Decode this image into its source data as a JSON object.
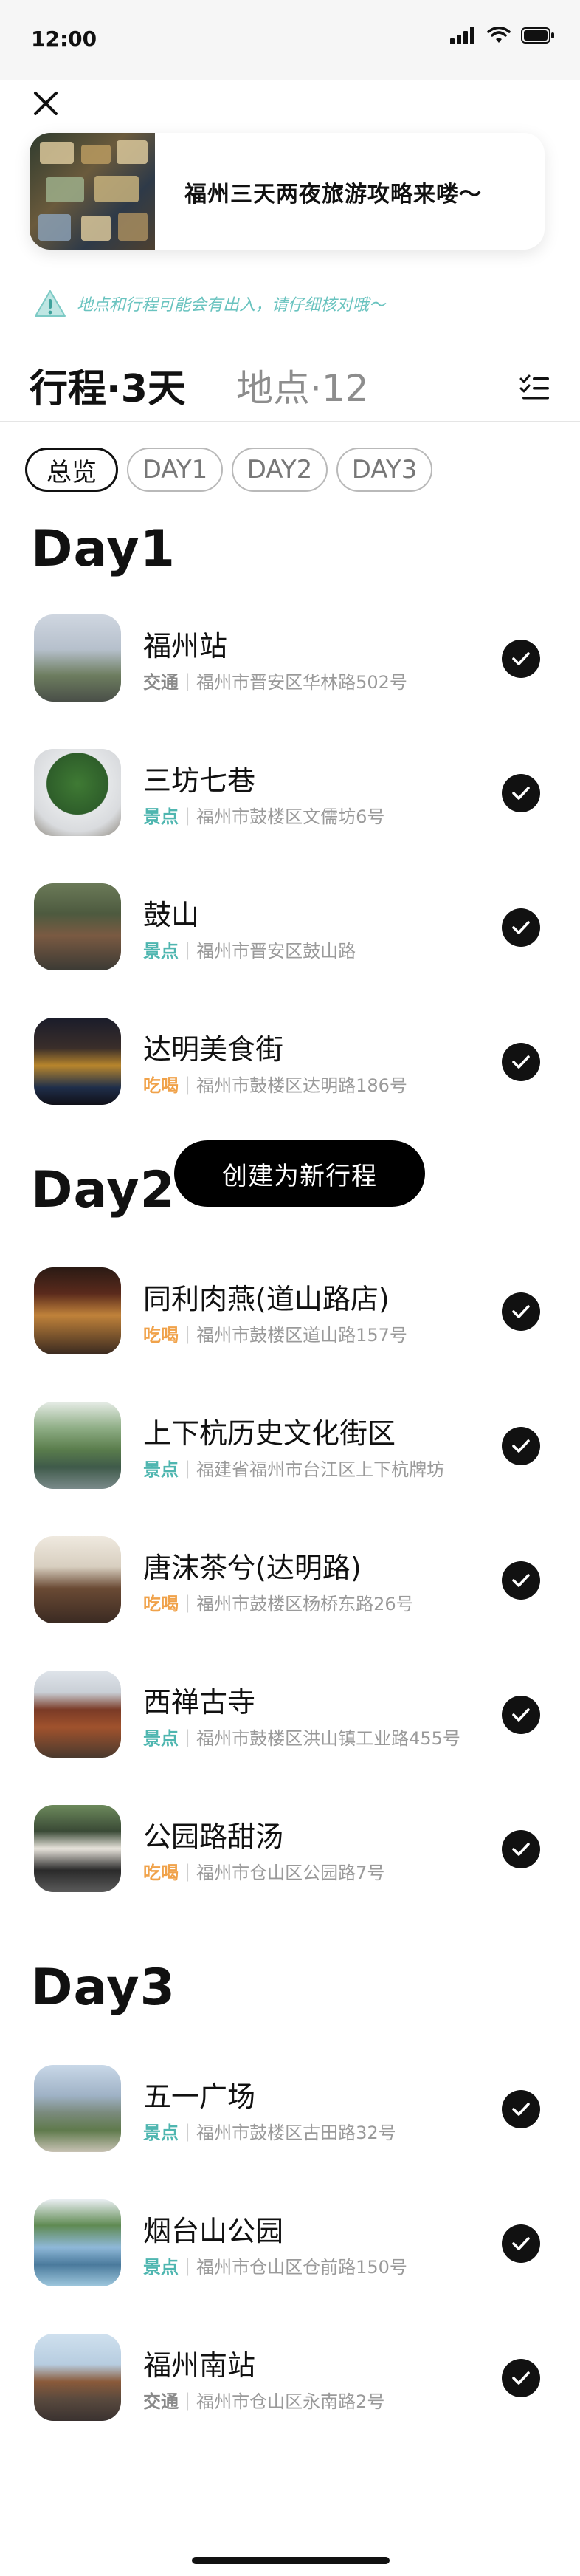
{
  "status_bar": {
    "time": "12:00"
  },
  "guide_card": {
    "title": "福州三天两夜旅游攻略来喽～"
  },
  "notice": {
    "text": "地点和行程可能会有出入，请仔细核对哦～"
  },
  "tabs": {
    "itinerary": "行程·3天",
    "places": "地点·12"
  },
  "chips": [
    "总览",
    "DAY1",
    "DAY2",
    "DAY3"
  ],
  "days": [
    {
      "title": "Day1",
      "items": [
        {
          "name": "福州站",
          "category": "交通",
          "address": "福州市晋安区华林路502号"
        },
        {
          "name": "三坊七巷",
          "category": "景点",
          "address": "福州市鼓楼区文儒坊6号"
        },
        {
          "name": "鼓山",
          "category": "景点",
          "address": "福州市晋安区鼓山路"
        },
        {
          "name": "达明美食街",
          "category": "吃喝",
          "address": "福州市鼓楼区达明路186号"
        }
      ]
    },
    {
      "title": "Day2",
      "items": [
        {
          "name": "同利肉燕(道山路店)",
          "category": "吃喝",
          "address": "福州市鼓楼区道山路157号"
        },
        {
          "name": "上下杭历史文化街区",
          "category": "景点",
          "address": "福建省福州市台江区上下杭牌坊"
        },
        {
          "name": "唐沫茶兮(达明路)",
          "category": "吃喝",
          "address": "福州市鼓楼区杨桥东路26号"
        },
        {
          "name": "西禅古寺",
          "category": "景点",
          "address": "福州市鼓楼区洪山镇工业路455号"
        },
        {
          "name": "公园路甜汤",
          "category": "吃喝",
          "address": "福州市仓山区公园路7号"
        }
      ]
    },
    {
      "title": "Day3",
      "items": [
        {
          "name": "五一广场",
          "category": "景点",
          "address": "福州市鼓楼区古田路32号"
        },
        {
          "name": "烟台山公园",
          "category": "景点",
          "address": "福州市仓山区仓前路150号"
        },
        {
          "name": "福州南站",
          "category": "交通",
          "address": "福州市仓山区永南路2号"
        }
      ]
    }
  ],
  "create_button": {
    "label": "创建为新行程"
  },
  "colors": {
    "transport": "#8a8a8a",
    "sight": "#4fb6b0",
    "food": "#f0a24a",
    "accent": "#69c3bf"
  }
}
